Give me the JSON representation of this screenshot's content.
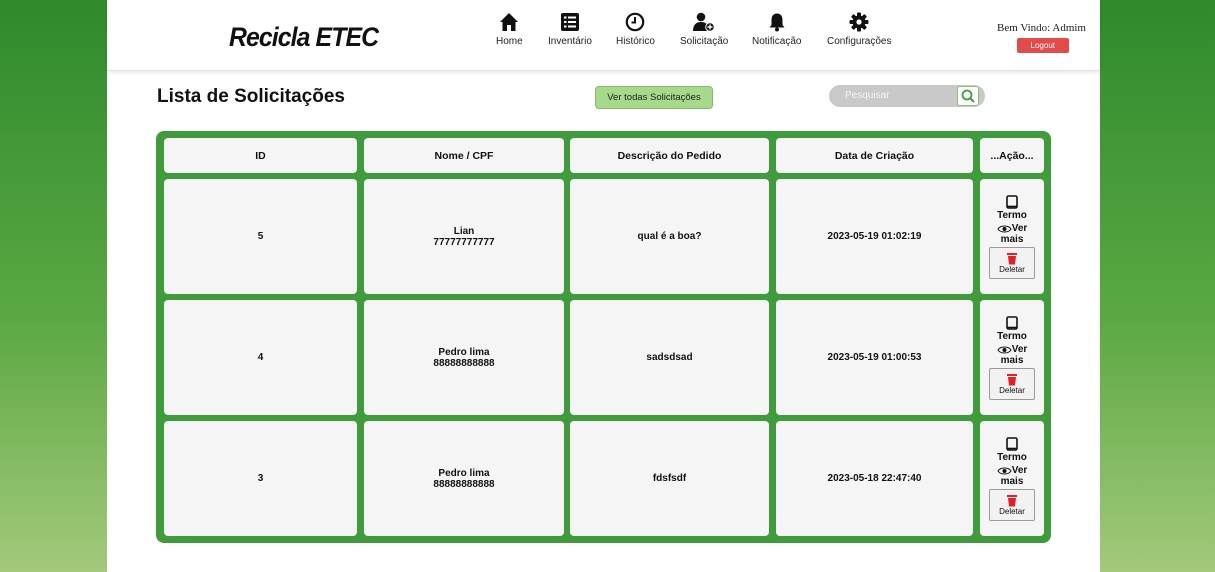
{
  "brand": {
    "logo": "Recicla ETEC"
  },
  "nav": [
    {
      "label": "Home",
      "icon": "home-icon"
    },
    {
      "label": "Inventário",
      "icon": "list-icon"
    },
    {
      "label": "Histórico",
      "icon": "clock-icon"
    },
    {
      "label": "Solicitação",
      "icon": "add-user-icon"
    },
    {
      "label": "Notificação",
      "icon": "bell-icon"
    },
    {
      "label": "Configurações",
      "icon": "gear-icon"
    }
  ],
  "user": {
    "welcome": "Bem Vindo: Admim",
    "logout": "Logout"
  },
  "page": {
    "title": "Lista de Solicitações",
    "view_all": "Ver todas Solicitações",
    "search_placeholder": "Pesquisar"
  },
  "table": {
    "headers": [
      "ID",
      "Nome / CPF",
      "Descrição do Pedido",
      "Data de Criação",
      "...Ação..."
    ],
    "rows": [
      {
        "id": "5",
        "name": "Lian",
        "cpf": "77777777777",
        "desc": "qual é a boa?",
        "date": "2023-05-19 01:02:19"
      },
      {
        "id": "4",
        "name": "Pedro lima",
        "cpf": "88888888888",
        "desc": "sadsdsad",
        "date": "2023-05-19 01:00:53"
      },
      {
        "id": "3",
        "name": "Pedro lima",
        "cpf": "88888888888",
        "desc": "fdsfsdf",
        "date": "2023-05-18 22:47:40"
      }
    ],
    "actions": {
      "termo": "Termo",
      "ver": "Ver",
      "mais": "mais",
      "deletar": "Deletar"
    }
  },
  "colors": {
    "accent_green": "#3f9b3c",
    "logout_red": "#e34b4b",
    "button_green": "#a6d98b"
  }
}
